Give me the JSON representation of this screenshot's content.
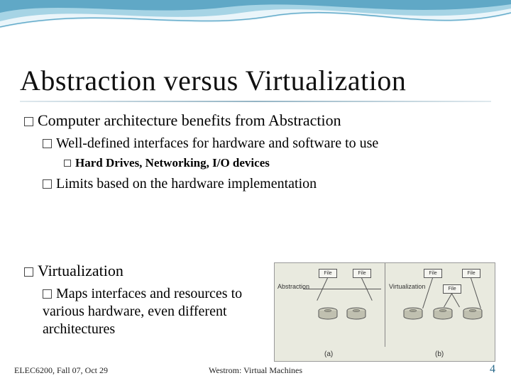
{
  "title": "Abstraction versus Virtualization",
  "l1a": "Computer architecture benefits from Abstraction",
  "l2a": "Well-defined interfaces for hardware and software to use",
  "l3a": "Hard Drives, Networking, I/O devices",
  "l2b": "Limits based on the hardware implementation",
  "l1b": "Virtualization",
  "l2c": "Maps interfaces and resources to various hardware, even different architectures",
  "footer": {
    "left": "ELEC6200, Fall 07, Oct 29",
    "center": "Westrom: Virtual Machines",
    "right": "4"
  },
  "diagram": {
    "left_label": "Abstraction",
    "right_label": "Virtualization",
    "file": "File",
    "sub_a": "(a)",
    "sub_b": "(b)"
  }
}
